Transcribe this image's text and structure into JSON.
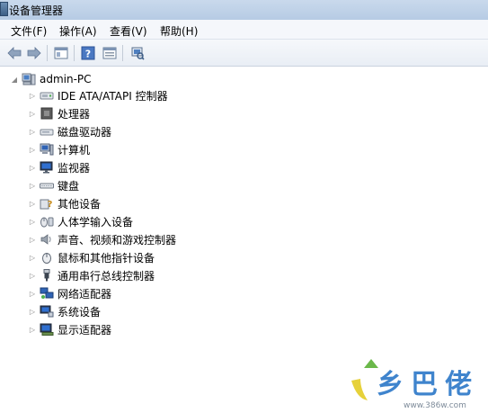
{
  "window": {
    "title": "设备管理器"
  },
  "menu": [
    {
      "label": "文件(F)"
    },
    {
      "label": "操作(A)"
    },
    {
      "label": "查看(V)"
    },
    {
      "label": "帮助(H)"
    }
  ],
  "toolbar": {
    "icons": [
      "back-arrow-icon",
      "forward-arrow-icon",
      "show-hide-console-tree-icon",
      "help-icon",
      "properties-icon",
      "scan-hardware-icon"
    ]
  },
  "tree": {
    "root": {
      "label": "admin-PC",
      "icon": "computer-icon"
    },
    "items": [
      {
        "label": "IDE ATA/ATAPI 控制器",
        "icon": "ide-controller-icon"
      },
      {
        "label": "处理器",
        "icon": "processor-icon"
      },
      {
        "label": "磁盘驱动器",
        "icon": "disk-drive-icon"
      },
      {
        "label": "计算机",
        "icon": "computer-icon"
      },
      {
        "label": "监视器",
        "icon": "monitor-icon"
      },
      {
        "label": "键盘",
        "icon": "keyboard-icon"
      },
      {
        "label": "其他设备",
        "icon": "unknown-device-icon"
      },
      {
        "label": "人体学输入设备",
        "icon": "hid-icon"
      },
      {
        "label": "声音、视频和游戏控制器",
        "icon": "speaker-icon"
      },
      {
        "label": "鼠标和其他指针设备",
        "icon": "mouse-icon"
      },
      {
        "label": "通用串行总线控制器",
        "icon": "usb-icon"
      },
      {
        "label": "网络适配器",
        "icon": "network-adapter-icon"
      },
      {
        "label": "系统设备",
        "icon": "system-device-icon"
      },
      {
        "label": "显示适配器",
        "icon": "display-adapter-icon"
      }
    ]
  },
  "watermark": {
    "brand": "乡巴佬",
    "url": "www.386w.com"
  }
}
